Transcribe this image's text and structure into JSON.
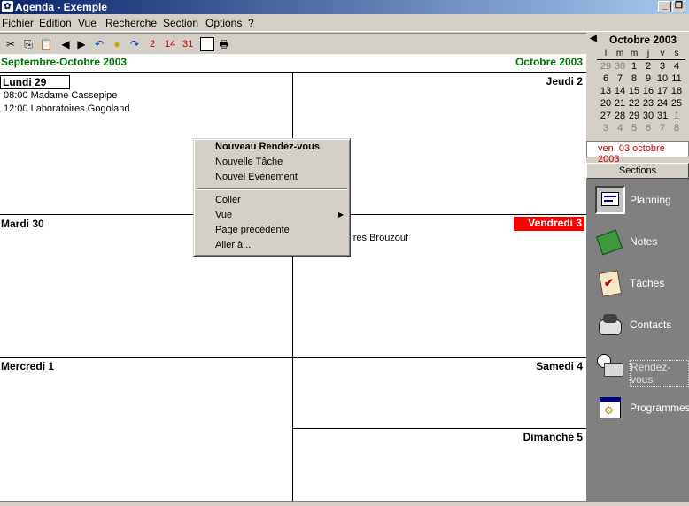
{
  "window": {
    "title": "Agenda - Exemple"
  },
  "menu": [
    "Fichier",
    "Edition",
    "Vue",
    "Recherche",
    "Section",
    "Options",
    "?"
  ],
  "toolbar": {
    "day_buttons": [
      "2",
      "14",
      "31"
    ]
  },
  "main": {
    "period_left": "Septembre-Octobre 2003",
    "period_right": "Octobre 2003",
    "days": {
      "lundi": "Lundi 29",
      "jeudi": "Jeudi 2",
      "mardi": "Mardi 30",
      "vendredi": "Vendredi 3",
      "mercredi": "Mercredi 1",
      "samedi": "Samedi 4",
      "dimanche": "Dimanche 5"
    },
    "events": {
      "lundi_1": "08:00 Madame Cassepipe",
      "lundi_2": "12:00 Laboratoires Gogoland",
      "vendredi_1": "atoires Brouzouf"
    }
  },
  "context_menu": {
    "new_appointment": "Nouveau Rendez-vous",
    "new_task": "Nouvelle Tâche",
    "new_event": "Nouvel Evènement",
    "paste": "Coller",
    "view": "Vue",
    "previous_page": "Page précédente",
    "go_to": "Aller à..."
  },
  "mini_calendar": {
    "month": "Octobre 2003",
    "weekdays": [
      "l",
      "m",
      "m",
      "j",
      "v",
      "s"
    ],
    "weeks": [
      [
        "29",
        "30",
        "1",
        "2",
        "3",
        "4"
      ],
      [
        "6",
        "7",
        "8",
        "9",
        "10",
        "11"
      ],
      [
        "13",
        "14",
        "15",
        "16",
        "17",
        "18"
      ],
      [
        "20",
        "21",
        "22",
        "23",
        "24",
        "25"
      ],
      [
        "27",
        "28",
        "29",
        "30",
        "31",
        "1"
      ],
      [
        "3",
        "4",
        "5",
        "6",
        "7",
        "8"
      ]
    ],
    "selected_date": "ven. 03 octobre 2003"
  },
  "sections": {
    "header": "Sections",
    "items": [
      "Planning",
      "Notes",
      "Tâches",
      "Contacts",
      "Rendez-vous",
      "Programmes"
    ]
  }
}
